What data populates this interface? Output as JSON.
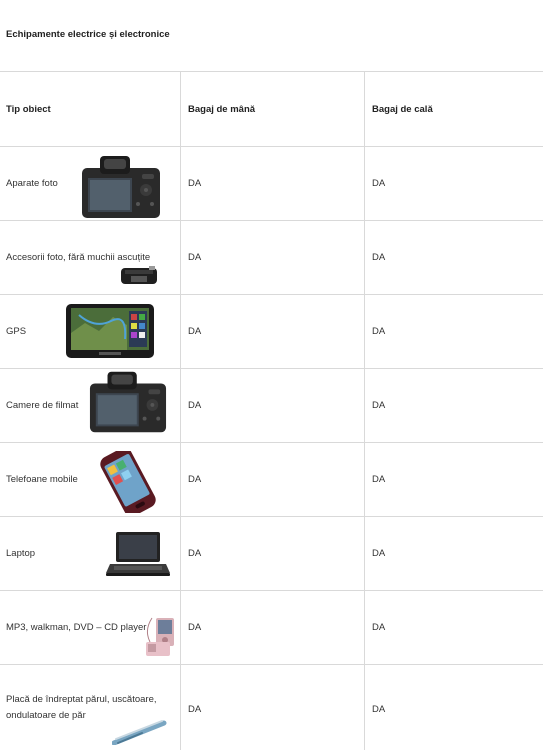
{
  "title": "Echipamente electrice și electronice",
  "table": {
    "headers": [
      "Tip obiect",
      "Bagaj de mână",
      "Bagaj de cală"
    ],
    "rows": [
      {
        "item": "Aparate foto",
        "hand": "DA",
        "hold": "DA",
        "icon": "camera-icon"
      },
      {
        "item": "Accesorii foto, fără muchii ascuțite",
        "hand": "DA",
        "hold": "DA",
        "icon": "lens-adapter-icon"
      },
      {
        "item": "GPS",
        "hand": "DA",
        "hold": "DA",
        "icon": "gps-icon"
      },
      {
        "item": "Camere de filmat",
        "hand": "DA",
        "hold": "DA",
        "icon": "video-camera-icon"
      },
      {
        "item": "Telefoane mobile",
        "hand": "DA",
        "hold": "DA",
        "icon": "mobile-phone-icon"
      },
      {
        "item": "Laptop",
        "hand": "DA",
        "hold": "DA",
        "icon": "laptop-icon"
      },
      {
        "item": "MP3, walkman, DVD – CD player",
        "hand": "DA",
        "hold": "DA",
        "icon": "mp3-player-icon"
      },
      {
        "item": "Placă de îndreptat părul, uscătoare, ondulatoare de păr",
        "hand": "DA",
        "hold": "DA",
        "icon": "hair-straightener-icon"
      }
    ]
  }
}
